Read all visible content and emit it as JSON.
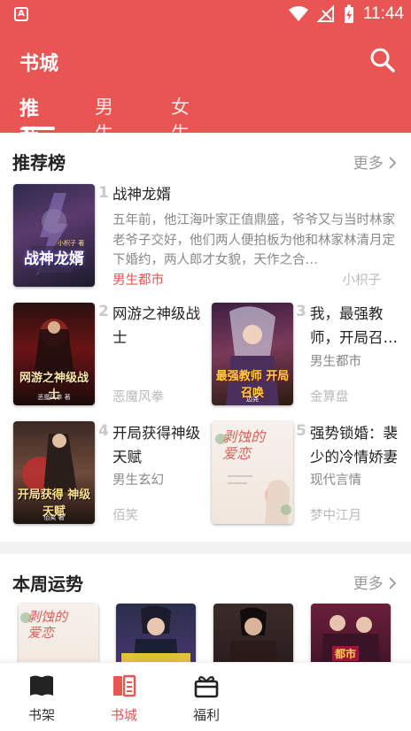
{
  "status_bar": {
    "time": "11:44",
    "app_icon_letter": "A"
  },
  "header": {
    "title": "书城",
    "search_icon": "search-icon"
  },
  "tabs": [
    {
      "label": "推荐",
      "active": true
    },
    {
      "label": "男生",
      "active": false
    },
    {
      "label": "女生",
      "active": false
    }
  ],
  "ranking": {
    "title": "推荐榜",
    "more": "更多",
    "featured": {
      "rank": "1",
      "title": "战神龙婿",
      "desc": "五年前，他江海叶家正值鼎盛，爷爷又与当时林家老爷子交好，他们两人便拍板为他和林家林清月定下婚约，两人郎才女貌，天作之合…",
      "tag": "男生都市",
      "author": "小枳子",
      "cover_text": "战神龙婿",
      "cover_sub": "小枳子 著"
    },
    "books": [
      {
        "rank": "2",
        "title": "网游之神级战士",
        "author": "恶魔风拳",
        "category": "",
        "cover_text": "网游之神级战士",
        "cover_sub": "恶魔风拳 著"
      },
      {
        "rank": "3",
        "title": "我，最强教师，开局召…",
        "author": "金算盘",
        "category": "男生都市",
        "cover_text": "最强教师 开局召唤",
        "cover_sub": "边尧"
      },
      {
        "rank": "4",
        "title": "开局获得神级天赋",
        "author": "佰笑",
        "category": "男生玄幻",
        "cover_text": "开局获得 神级天赋",
        "cover_sub": "佰笑 著"
      },
      {
        "rank": "5",
        "title": "强势锁婚：裴少的冷情娇妻",
        "author": "梦中江月",
        "category": "现代言情",
        "cover_text": "剥蚀的 爱恋",
        "cover_sub": ""
      }
    ]
  },
  "weekly": {
    "title": "本周运势",
    "more": "更多",
    "covers": [
      {
        "cover_text": "剥蚀的 爱恋"
      },
      {
        "cover_text": ""
      },
      {
        "cover_text": ""
      },
      {
        "cover_text": "都市"
      }
    ]
  },
  "bottom_nav": [
    {
      "label": "书架",
      "icon": "bookshelf-icon",
      "active": false
    },
    {
      "label": "书城",
      "icon": "bookstore-icon",
      "active": true
    },
    {
      "label": "福利",
      "icon": "gift-icon",
      "active": false
    }
  ],
  "colors": {
    "brand_red": "#e95553",
    "muted_text": "#888888",
    "rank_gray": "#c9c9c9"
  }
}
